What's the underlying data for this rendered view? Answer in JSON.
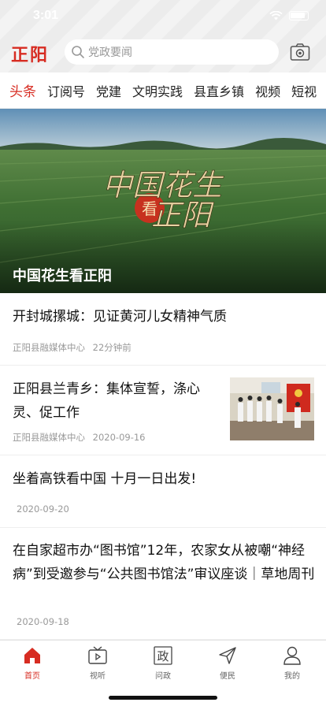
{
  "status_bar": {
    "time": "3:01"
  },
  "header": {
    "logo": "正阳",
    "search_placeholder": "党政要闻"
  },
  "tabs": [
    {
      "label": "头条",
      "active": true
    },
    {
      "label": "订阅号",
      "active": false
    },
    {
      "label": "党建",
      "active": false
    },
    {
      "label": "文明实践",
      "active": false
    },
    {
      "label": "县直乡镇",
      "active": false
    },
    {
      "label": "视频",
      "active": false
    },
    {
      "label": "短视",
      "active": false
    }
  ],
  "banner": {
    "title": "中国花生看正阳",
    "calligraphy": "中国花生看正阳"
  },
  "news": [
    {
      "title": "开封城摞城：见证黄河儿女精神气质",
      "source": "正阳县融媒体中心",
      "time": "22分钟前"
    },
    {
      "title": "正阳县兰青乡：集体宣誓，涤心灵、促工作",
      "source": "正阳县融媒体中心",
      "time": "2020-09-16"
    },
    {
      "title": "坐着高铁看中国 十月一日出发!",
      "source": "",
      "time": "2020-09-20"
    },
    {
      "title": "在自家超市办“图书馆”12年，农家女从被嘲“神经病”到受邀参与“公共图书馆法”审议座谈｜草地周刊",
      "source": "",
      "time": "2020-09-18"
    }
  ],
  "tabbar": [
    {
      "label": "首页",
      "icon": "home-icon",
      "active": true
    },
    {
      "label": "视听",
      "icon": "tv-icon",
      "active": false
    },
    {
      "label": "问政",
      "icon": "zheng-icon",
      "active": false
    },
    {
      "label": "便民",
      "icon": "send-icon",
      "active": false
    },
    {
      "label": "我的",
      "icon": "user-icon",
      "active": false
    }
  ],
  "colors": {
    "accent": "#d72c22",
    "text": "#111111",
    "meta": "#999999"
  }
}
